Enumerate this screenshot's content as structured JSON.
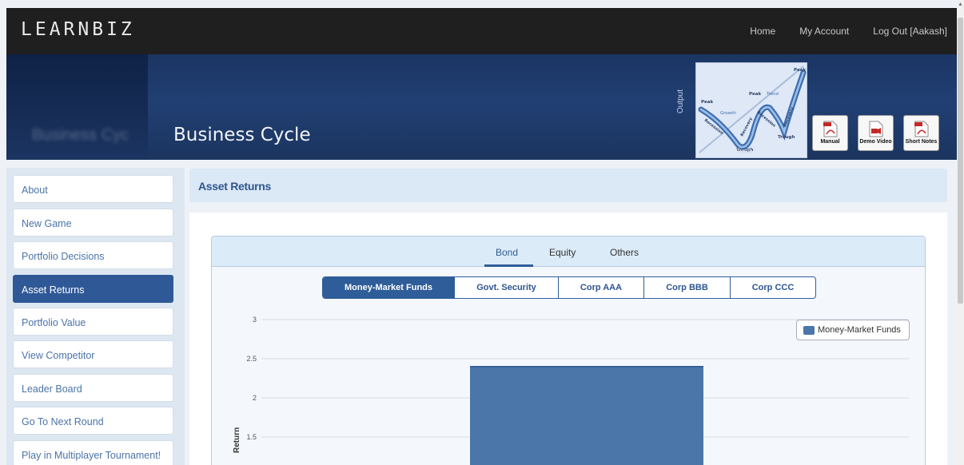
{
  "app": {
    "logo": "LEARNBIZ",
    "nav": [
      "Home",
      "My Account",
      "Log Out [Aakash]"
    ]
  },
  "banner": {
    "title": "Business Cycle",
    "ghost_title": "Business Cyc",
    "cycle_image": {
      "y_label": "Output",
      "x_label": "Time",
      "labels": [
        "Peak",
        "Growth",
        "Trend",
        "Peak",
        "Peak",
        "Recession",
        "Recovery",
        "Recession",
        "Recovery",
        "Trough",
        "Trough"
      ]
    },
    "resources": [
      {
        "label": "Manual",
        "icon": "pdf-icon"
      },
      {
        "label": "Demo Video",
        "icon": "video-icon"
      },
      {
        "label": "Short Notes",
        "icon": "pdf-icon"
      }
    ]
  },
  "sidebar": {
    "items": [
      {
        "label": "About",
        "active": false
      },
      {
        "label": "New Game",
        "active": false
      },
      {
        "label": "Portfolio Decisions",
        "active": false
      },
      {
        "label": "Asset Returns",
        "active": true
      },
      {
        "label": "Portfolio Value",
        "active": false
      },
      {
        "label": "View Competitor",
        "active": false
      },
      {
        "label": "Leader Board",
        "active": false
      },
      {
        "label": "Go To Next Round",
        "active": false
      },
      {
        "label": "Play in Multiplayer Tournament!",
        "active": false
      }
    ]
  },
  "main": {
    "title": "Asset Returns",
    "tabs": [
      {
        "label": "Bond",
        "active": true
      },
      {
        "label": "Equity",
        "active": false
      },
      {
        "label": "Others",
        "active": false
      }
    ],
    "subtabs": [
      {
        "label": "Money-Market Funds",
        "active": true
      },
      {
        "label": "Govt. Security",
        "active": false
      },
      {
        "label": "Corp AAA",
        "active": false
      },
      {
        "label": "Corp BBB",
        "active": false
      },
      {
        "label": "Corp CCC",
        "active": false
      }
    ]
  },
  "colors": {
    "accent": "#2e5d99",
    "bar": "#4a76aa",
    "banner": "#213f73"
  },
  "chart_data": {
    "type": "bar",
    "ylabel": "Return",
    "yticks": [
      "3",
      "2.5",
      "2",
      "1.5"
    ],
    "ylim": [
      1.5,
      3
    ],
    "grid": true,
    "legend_position": "top-right",
    "series": [
      {
        "name": "Money-Market Funds",
        "values": [
          2.4
        ]
      }
    ]
  }
}
